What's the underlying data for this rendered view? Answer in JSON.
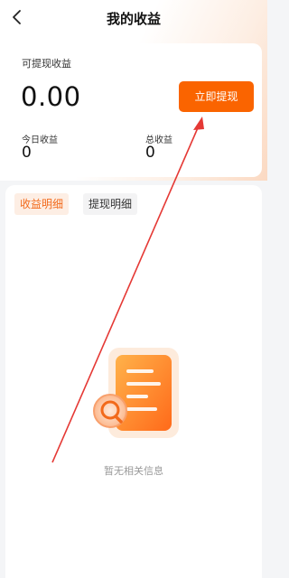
{
  "header": {
    "title": "我的收益",
    "back_icon": "chevron-left-icon"
  },
  "earnings": {
    "label": "可提现收益",
    "amount": "0.00",
    "withdraw_label": "立即提现",
    "today_label": "今日收益",
    "today_value": "0",
    "total_label": "总收益",
    "total_value": "0"
  },
  "tabs": [
    {
      "label": "收益明细",
      "active": true
    },
    {
      "label": "提现明细",
      "active": false
    }
  ],
  "empty": {
    "text": "暂无相关信息",
    "icon": "empty-document-search-icon"
  },
  "colors": {
    "accent": "#fa6400",
    "annotation_arrow": "#e53935"
  }
}
